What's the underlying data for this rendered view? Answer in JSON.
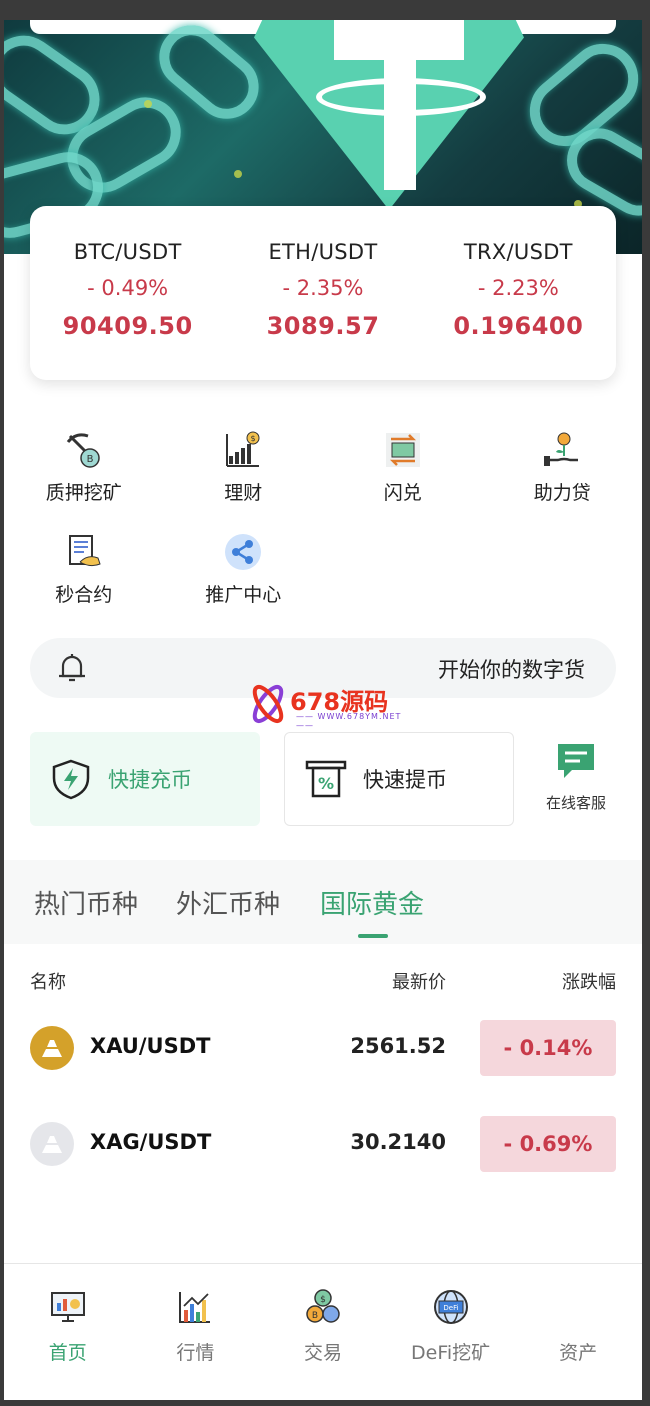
{
  "ticker": [
    {
      "pair": "BTC/USDT",
      "change": "- 0.49%",
      "price": "90409.50"
    },
    {
      "pair": "ETH/USDT",
      "change": "- 2.35%",
      "price": "3089.57"
    },
    {
      "pair": "TRX/USDT",
      "change": "- 2.23%",
      "price": "0.196400"
    }
  ],
  "menu": {
    "row1": [
      "质押挖矿",
      "理财",
      "闪兑",
      "助力贷"
    ],
    "row2": [
      "秒合约",
      "推广中心"
    ]
  },
  "notice": {
    "text": "开始你的数字货"
  },
  "watermark": {
    "brand": "678源码",
    "url": "—— WWW.678YM.NET ——"
  },
  "actions": {
    "deposit": "快捷充币",
    "withdraw": "快速提币",
    "service": "在线客服"
  },
  "tabs": {
    "hot": "热门币种",
    "forex": "外汇币种",
    "gold": "国际黄金",
    "active": "gold"
  },
  "table": {
    "headers": {
      "name": "名称",
      "price": "最新价",
      "change": "涨跌幅"
    },
    "rows": [
      {
        "symbol": "XAU/USDT",
        "price": "2561.52",
        "change": "- 0.14%",
        "coin_color": "#d4a12a"
      },
      {
        "symbol": "XAG/USDT",
        "price": "30.2140",
        "change": "- 0.69%",
        "coin_color": "#e5e6ea"
      }
    ]
  },
  "nav": {
    "home": "首页",
    "market": "行情",
    "trade": "交易",
    "defi": "DeFi挖矿",
    "assets": "资产",
    "active": "home"
  },
  "colors": {
    "accent": "#3aa372",
    "down": "#c83a4a",
    "down_bg": "#f5d7dc"
  }
}
